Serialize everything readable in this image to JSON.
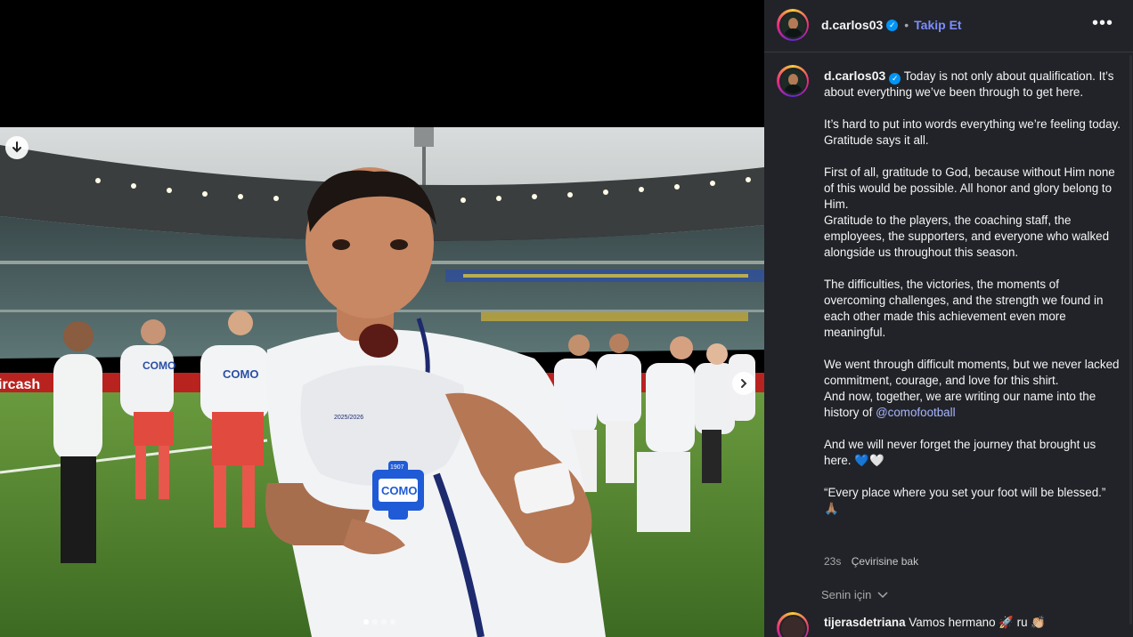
{
  "post": {
    "username": "d.carlos03",
    "follow_label": "Takip Et",
    "more_label": "•••",
    "caption_lines": [
      "Today is not only about qualification. It’s about everything we’ve been through to get here.",
      "",
      "It’s hard to put into words everything we’re feeling today. Gratitude says it all.",
      "",
      "First of all, gratitude to God, because without Him none of this would be possible. All honor and glory belong to Him.",
      "Gratitude to the players, the coaching staff, the employees, the supporters, and everyone who walked alongside us throughout this season.",
      "",
      "The difficulties, the victories, the moments of overcoming challenges, and the strength we found in each other made this achievement even more meaningful.",
      "",
      "We went through difficult moments, but we never lacked commitment, courage, and love for this shirt."
    ],
    "caption_line_with_mention_prefix": "And now, together, we are writing our name into the history of ",
    "mention": "@comofootball",
    "caption_before_journey": "And now, together, we are writing our name into the history of @comofootball",
    "journey_text": "And we will never forget the journey that brought us here.",
    "journey_emojis": [
      "💙",
      "🤍"
    ],
    "quote_text": "“Every place where you set your foot will be blessed.”",
    "quote_emoji": "🙏🏽",
    "time_ago": "23s",
    "translate_label": "Çevirisine bak",
    "for_you_label": "Senin için",
    "comment": {
      "username": "tijerasdetriana",
      "text": "Vamos hermano 🚀 ru 👏🏼"
    }
  },
  "media": {
    "jersey_text": "COMO",
    "jersey_year": "1907",
    "shirt_patch": "2025/2026",
    "banner_text": "ircash",
    "carousel_total": 4,
    "carousel_active": 1,
    "icons": {
      "download": "download-icon",
      "next": "chevron-right-icon",
      "verified": "verified-badge-icon",
      "more": "more-options-icon",
      "chevron": "chevron-down-icon"
    }
  },
  "colors": {
    "panel_bg": "#212328",
    "follow": "#7d8cff",
    "mention": "#a7b5ff",
    "verified": "#0095f6"
  }
}
